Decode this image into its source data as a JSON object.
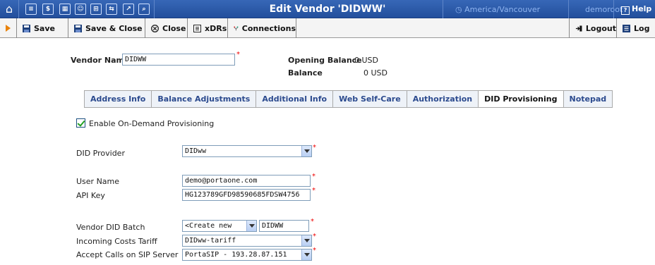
{
  "window": {
    "title": "Edit Vendor 'DIDWW'",
    "timezone": "America/Vancouver",
    "user": "demoroot",
    "help_label": "Help"
  },
  "toolbar": {
    "save": "Save",
    "save_close": "Save & Close",
    "close": "Close",
    "xdrs": "xDRs",
    "connections": "Connections",
    "logout": "Logout",
    "log": "Log"
  },
  "vendor": {
    "name_label": "Vendor Name",
    "name_value": "DIDWW",
    "opening_balance_label": "Opening Balance",
    "opening_balance_value": "0 USD",
    "balance_label": "Balance",
    "balance_value": "0 USD"
  },
  "tabs": [
    "Address Info",
    "Balance Adjustments",
    "Additional Info",
    "Web Self-Care",
    "Authorization",
    "DID Provisioning",
    "Notepad"
  ],
  "active_tab": "DID Provisioning",
  "did": {
    "enable_label": "Enable On-Demand Provisioning",
    "enable_checked": true,
    "provider_label": "DID Provider",
    "provider_value": "DIDww",
    "username_label": "User Name",
    "username_value": "demo@portaone.com",
    "apikey_label": "API Key",
    "apikey_value": "HG123789GFD98590685FDSW4756",
    "batch_label": "Vendor DID Batch",
    "batch_select_value": "<Create new",
    "batch_input_value": "DIDWW",
    "tariff_label": "Incoming Costs Tariff",
    "tariff_value": "DIDww-tariff",
    "sip_label": "Accept Calls on SIP Server",
    "sip_value": "PortaSIP - 193.28.87.151"
  },
  "colors": {
    "titlebar": "#2c59a8",
    "tab_text": "#2b4a8e",
    "required": "#ee0000",
    "arrow": "#e9820a"
  }
}
